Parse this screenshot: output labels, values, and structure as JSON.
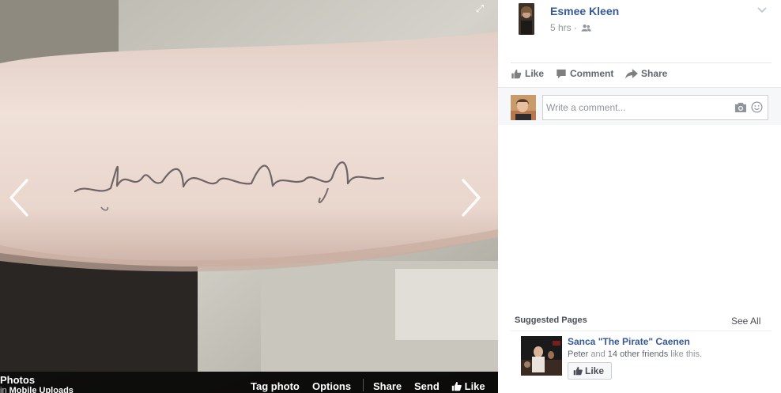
{
  "photo": {
    "tattoo_text": "live love laugh",
    "expand_icon": "expand-icon"
  },
  "footer": {
    "album_title": "Photos",
    "album_prefix": "in",
    "album_name": "Mobile Uploads",
    "tag_photo": "Tag photo",
    "options": "Options",
    "share": "Share",
    "send": "Send",
    "like": "Like"
  },
  "post": {
    "author": "Esmee Kleen",
    "time": "5 hrs ·",
    "audience_icon": "friends-icon"
  },
  "actions": {
    "like": "Like",
    "comment": "Comment",
    "share": "Share"
  },
  "comment": {
    "placeholder": "Write a comment..."
  },
  "suggested": {
    "header": "Suggested Pages",
    "see_all": "See All",
    "page_name": "Sanca \"The Pirate\" Caenen",
    "friends_name": "Peter",
    "friends_middle": "and",
    "friends_count": "14 other friends",
    "friends_suffix": "like this.",
    "like_button": "Like"
  },
  "colors": {
    "link_blue": "#365899",
    "muted_gray": "#90949c",
    "footer_bg": "#000000"
  }
}
